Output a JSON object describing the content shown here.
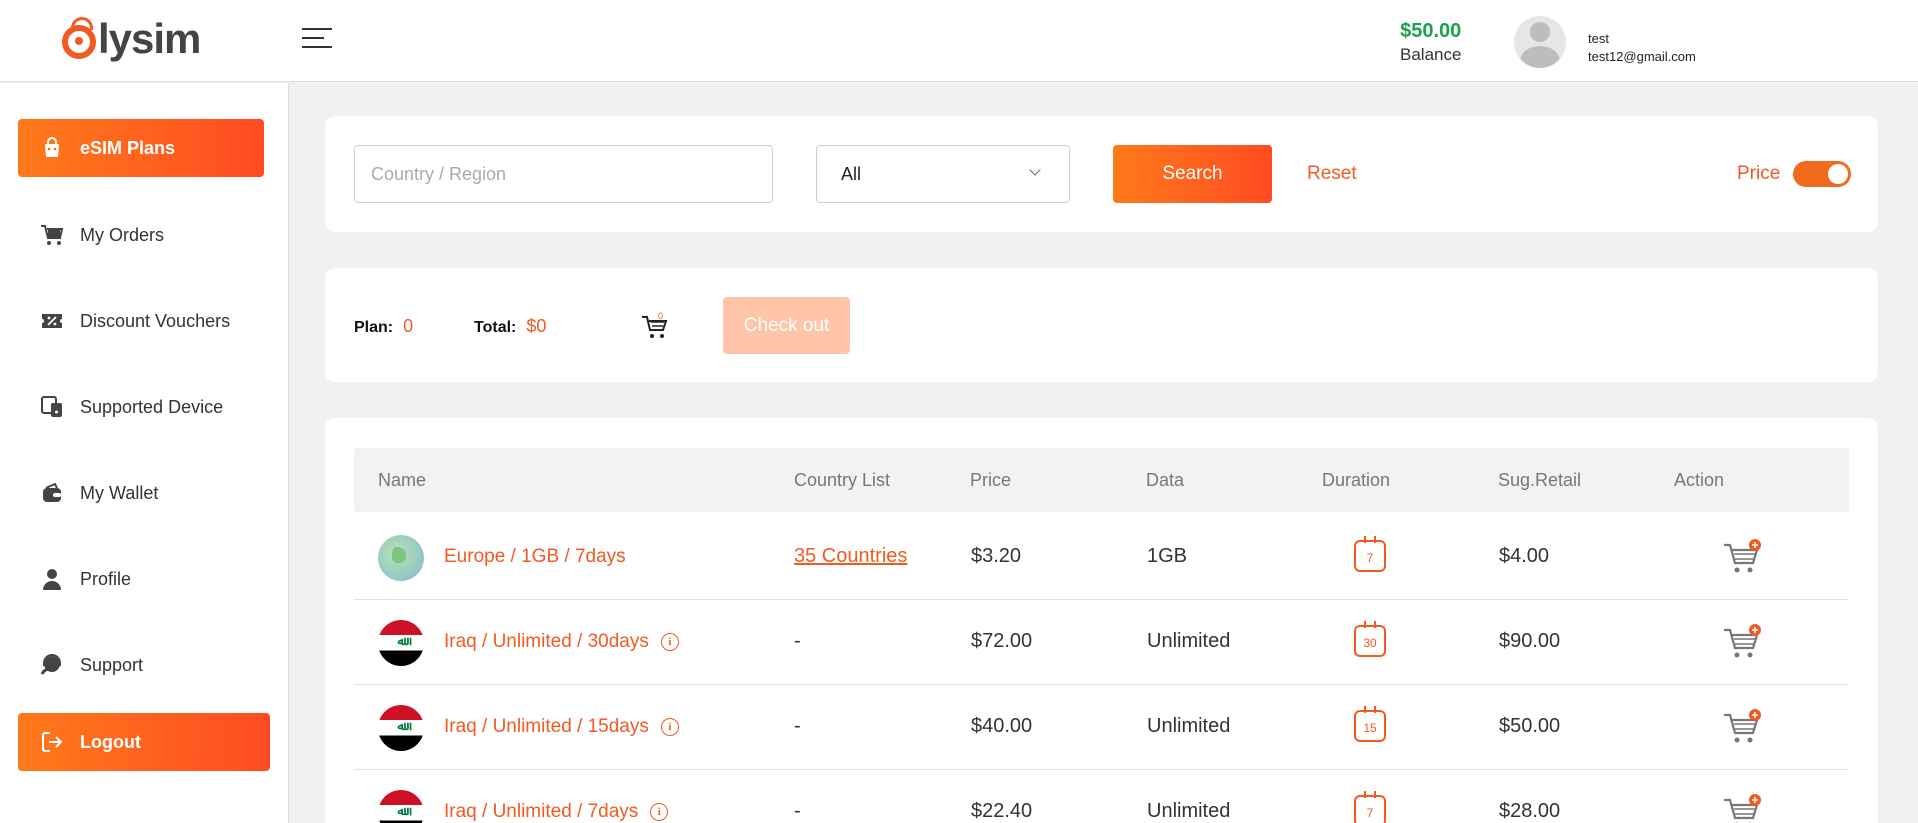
{
  "header": {
    "logo_text": "lysim",
    "balance_amount": "$50.00",
    "balance_label": "Balance",
    "user_name": "test",
    "user_email": "test12@gmail.com"
  },
  "sidebar": {
    "items": [
      {
        "label": "eSIM Plans",
        "icon": "shopping-bag-icon",
        "active": true
      },
      {
        "label": "My Orders",
        "icon": "cart-icon"
      },
      {
        "label": "Discount Vouchers",
        "icon": "voucher-icon"
      },
      {
        "label": "Supported Device",
        "icon": "devices-icon"
      },
      {
        "label": "My Wallet",
        "icon": "wallet-icon"
      },
      {
        "label": "Profile",
        "icon": "user-icon"
      },
      {
        "label": "Support",
        "icon": "support-icon"
      }
    ],
    "logout_label": "Logout"
  },
  "search": {
    "country_placeholder": "Country / Region",
    "type_value": "All",
    "search_label": "Search",
    "reset_label": "Reset",
    "price_label": "Price",
    "price_toggle_on": true
  },
  "cart": {
    "plan_label": "Plan:",
    "plan_count": "0",
    "total_label": "Total:",
    "total_value": "$0",
    "cart_count": "0",
    "checkout_label": "Check out"
  },
  "table": {
    "headers": [
      "Name",
      "Country List",
      "Price",
      "Data",
      "Duration",
      "Sug.Retail",
      "Action"
    ],
    "rows": [
      {
        "flag": "europe",
        "name": "Europe / 1GB / 7days",
        "info": false,
        "countries": "35 Countries",
        "price": "$3.20",
        "data": "1GB",
        "duration": "7",
        "retail": "$4.00"
      },
      {
        "flag": "iraq",
        "name": "Iraq / Unlimited / 30days",
        "info": true,
        "countries": "-",
        "price": "$72.00",
        "data": "Unlimited",
        "duration": "30",
        "retail": "$90.00"
      },
      {
        "flag": "iraq",
        "name": "Iraq / Unlimited / 15days",
        "info": true,
        "countries": "-",
        "price": "$40.00",
        "data": "Unlimited",
        "duration": "15",
        "retail": "$50.00"
      },
      {
        "flag": "iraq",
        "name": "Iraq / Unlimited / 7days",
        "info": true,
        "countries": "-",
        "price": "$22.40",
        "data": "Unlimited",
        "duration": "7",
        "retail": "$28.00"
      }
    ]
  },
  "colors": {
    "accent": "#f15a22",
    "balance": "#1aa34a"
  }
}
